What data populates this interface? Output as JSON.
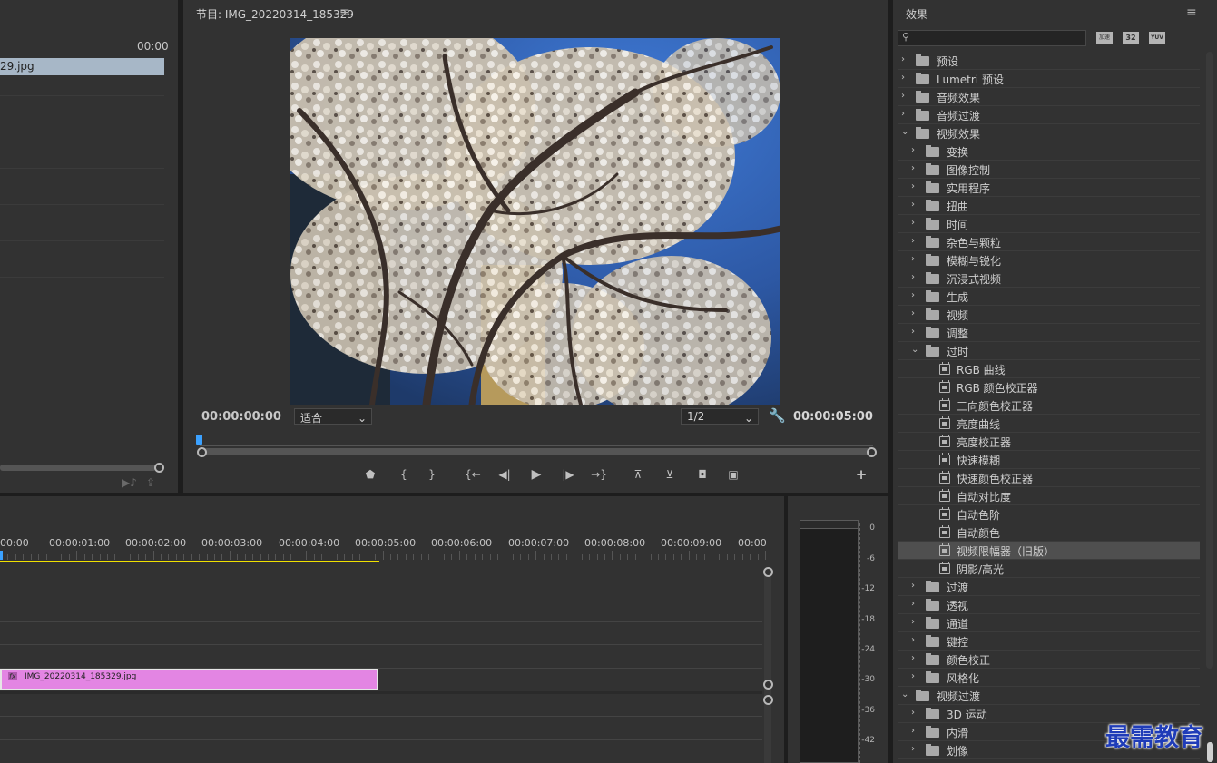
{
  "source": {
    "timecode": "00:00",
    "clip_label": "29.jpg"
  },
  "program": {
    "title": "节目: IMG_20220314_185329",
    "menu_icon": "hamburger-icon",
    "current_time": "00:00:00:00",
    "zoom": "适合",
    "resolution": "1/2",
    "duration": "00:00:05:00",
    "accent": "#3ba1ff",
    "buttons": [
      "add-marker",
      "mark-in",
      "mark-out",
      "go-to-in",
      "step-back",
      "play",
      "step-forward",
      "go-to-out",
      "lift",
      "extract",
      "export-frame",
      "compare-view",
      "add-button"
    ]
  },
  "timeline": {
    "ruler": [
      "00:00",
      "00:00:01:00",
      "00:00:02:00",
      "00:00:03:00",
      "00:00:04:00",
      "00:00:05:00",
      "00:00:06:00",
      "00:00:07:00",
      "00:00:08:00",
      "00:00:09:00",
      "00:00"
    ],
    "clip_name": "IMG_20220314_185329.jpg",
    "clip_badge": "fx",
    "clip_color": "#e385e3",
    "work_area_color": "#f0e000"
  },
  "meter": {
    "scale": [
      "0",
      "-6",
      "-12",
      "-18",
      "-24",
      "-30",
      "-36",
      "-42"
    ]
  },
  "effects": {
    "title": "效果",
    "search_placeholder": "",
    "filter_badges": [
      "加速",
      "32",
      "YUV"
    ],
    "items": [
      {
        "label": "预设",
        "level": 0,
        "expanded": false,
        "kind": "preset"
      },
      {
        "label": "Lumetri 预设",
        "level": 0,
        "expanded": false,
        "kind": "preset"
      },
      {
        "label": "音频效果",
        "level": 0,
        "expanded": false,
        "kind": "folder"
      },
      {
        "label": "音频过渡",
        "level": 0,
        "expanded": false,
        "kind": "folder"
      },
      {
        "label": "视频效果",
        "level": 0,
        "expanded": true,
        "kind": "folder"
      },
      {
        "label": "变换",
        "level": 1,
        "expanded": false,
        "kind": "folder"
      },
      {
        "label": "图像控制",
        "level": 1,
        "expanded": false,
        "kind": "folder"
      },
      {
        "label": "实用程序",
        "level": 1,
        "expanded": false,
        "kind": "folder"
      },
      {
        "label": "扭曲",
        "level": 1,
        "expanded": false,
        "kind": "folder"
      },
      {
        "label": "时间",
        "level": 1,
        "expanded": false,
        "kind": "folder"
      },
      {
        "label": "杂色与颗粒",
        "level": 1,
        "expanded": false,
        "kind": "folder"
      },
      {
        "label": "模糊与锐化",
        "level": 1,
        "expanded": false,
        "kind": "folder"
      },
      {
        "label": "沉浸式视频",
        "level": 1,
        "expanded": false,
        "kind": "folder"
      },
      {
        "label": "生成",
        "level": 1,
        "expanded": false,
        "kind": "folder"
      },
      {
        "label": "视频",
        "level": 1,
        "expanded": false,
        "kind": "folder"
      },
      {
        "label": "调整",
        "level": 1,
        "expanded": false,
        "kind": "folder"
      },
      {
        "label": "过时",
        "level": 1,
        "expanded": true,
        "kind": "folder"
      },
      {
        "label": "RGB 曲线",
        "level": 2,
        "kind": "effect"
      },
      {
        "label": "RGB 颜色校正器",
        "level": 2,
        "kind": "effect"
      },
      {
        "label": "三向颜色校正器",
        "level": 2,
        "kind": "effect"
      },
      {
        "label": "亮度曲线",
        "level": 2,
        "kind": "effect"
      },
      {
        "label": "亮度校正器",
        "level": 2,
        "kind": "effect"
      },
      {
        "label": "快速模糊",
        "level": 2,
        "kind": "effect"
      },
      {
        "label": "快速颜色校正器",
        "level": 2,
        "kind": "effect"
      },
      {
        "label": "自动对比度",
        "level": 2,
        "kind": "effect"
      },
      {
        "label": "自动色阶",
        "level": 2,
        "kind": "effect"
      },
      {
        "label": "自动颜色",
        "level": 2,
        "kind": "effect"
      },
      {
        "label": "视频限幅器（旧版）",
        "level": 2,
        "kind": "effect",
        "selected": true
      },
      {
        "label": "阴影/高光",
        "level": 2,
        "kind": "effect"
      },
      {
        "label": "过渡",
        "level": 1,
        "expanded": false,
        "kind": "folder"
      },
      {
        "label": "透视",
        "level": 1,
        "expanded": false,
        "kind": "folder"
      },
      {
        "label": "通道",
        "level": 1,
        "expanded": false,
        "kind": "folder"
      },
      {
        "label": "键控",
        "level": 1,
        "expanded": false,
        "kind": "folder"
      },
      {
        "label": "颜色校正",
        "level": 1,
        "expanded": false,
        "kind": "folder"
      },
      {
        "label": "风格化",
        "level": 1,
        "expanded": false,
        "kind": "folder"
      },
      {
        "label": "视频过渡",
        "level": 0,
        "expanded": true,
        "kind": "folder"
      },
      {
        "label": "3D 运动",
        "level": 1,
        "expanded": false,
        "kind": "folder"
      },
      {
        "label": "内滑",
        "level": 1,
        "expanded": false,
        "kind": "folder"
      },
      {
        "label": "划像",
        "level": 1,
        "expanded": false,
        "kind": "folder"
      }
    ]
  },
  "watermark": "最需教育"
}
